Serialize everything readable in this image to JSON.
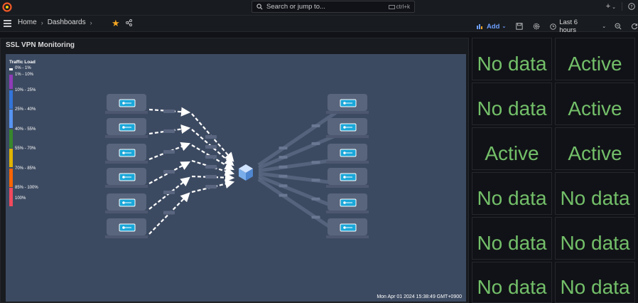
{
  "topbar": {
    "search_placeholder": "Search or jump to...",
    "shortcut": "ctrl+k",
    "plus_label": "+"
  },
  "breadcrumb": {
    "home": "Home",
    "dashboards": "Dashboards"
  },
  "toolbar": {
    "add_label": "Add",
    "time_range": "Last 6 hours"
  },
  "panel": {
    "title": "SSL VPN Monitoring",
    "timestamp": "Mon Apr 01 2024 15:38:49 GMT+0900",
    "legend_title": "Traffic Load",
    "legend": [
      {
        "label": "0% - 1%",
        "color": "#ffffff"
      },
      {
        "label": "1% - 10%",
        "color": "#8f3bb8"
      },
      {
        "label": "10% - 25%",
        "color": "#3274d9"
      },
      {
        "label": "25% - 40%",
        "color": "#5794f2"
      },
      {
        "label": "40% - 55%",
        "color": "#37872d"
      },
      {
        "label": "55% - 70%",
        "color": "#e0b400"
      },
      {
        "label": "70% - 85%",
        "color": "#fa6400"
      },
      {
        "label": "85% - 100%",
        "color": "#f2495c"
      },
      {
        "label": "100%",
        "color": "#f2495c"
      }
    ]
  },
  "stats": [
    {
      "value": "No data"
    },
    {
      "value": "Active"
    },
    {
      "value": "No data"
    },
    {
      "value": "Active"
    },
    {
      "value": "Active"
    },
    {
      "value": "Active"
    },
    {
      "value": "No data"
    },
    {
      "value": "No data"
    },
    {
      "value": "No data"
    },
    {
      "value": "No data"
    },
    {
      "value": "No data"
    },
    {
      "value": "No data"
    }
  ],
  "colors": {
    "stat_text": "#73bf69",
    "accent": "#6e9fff",
    "star": "#f5a623"
  }
}
